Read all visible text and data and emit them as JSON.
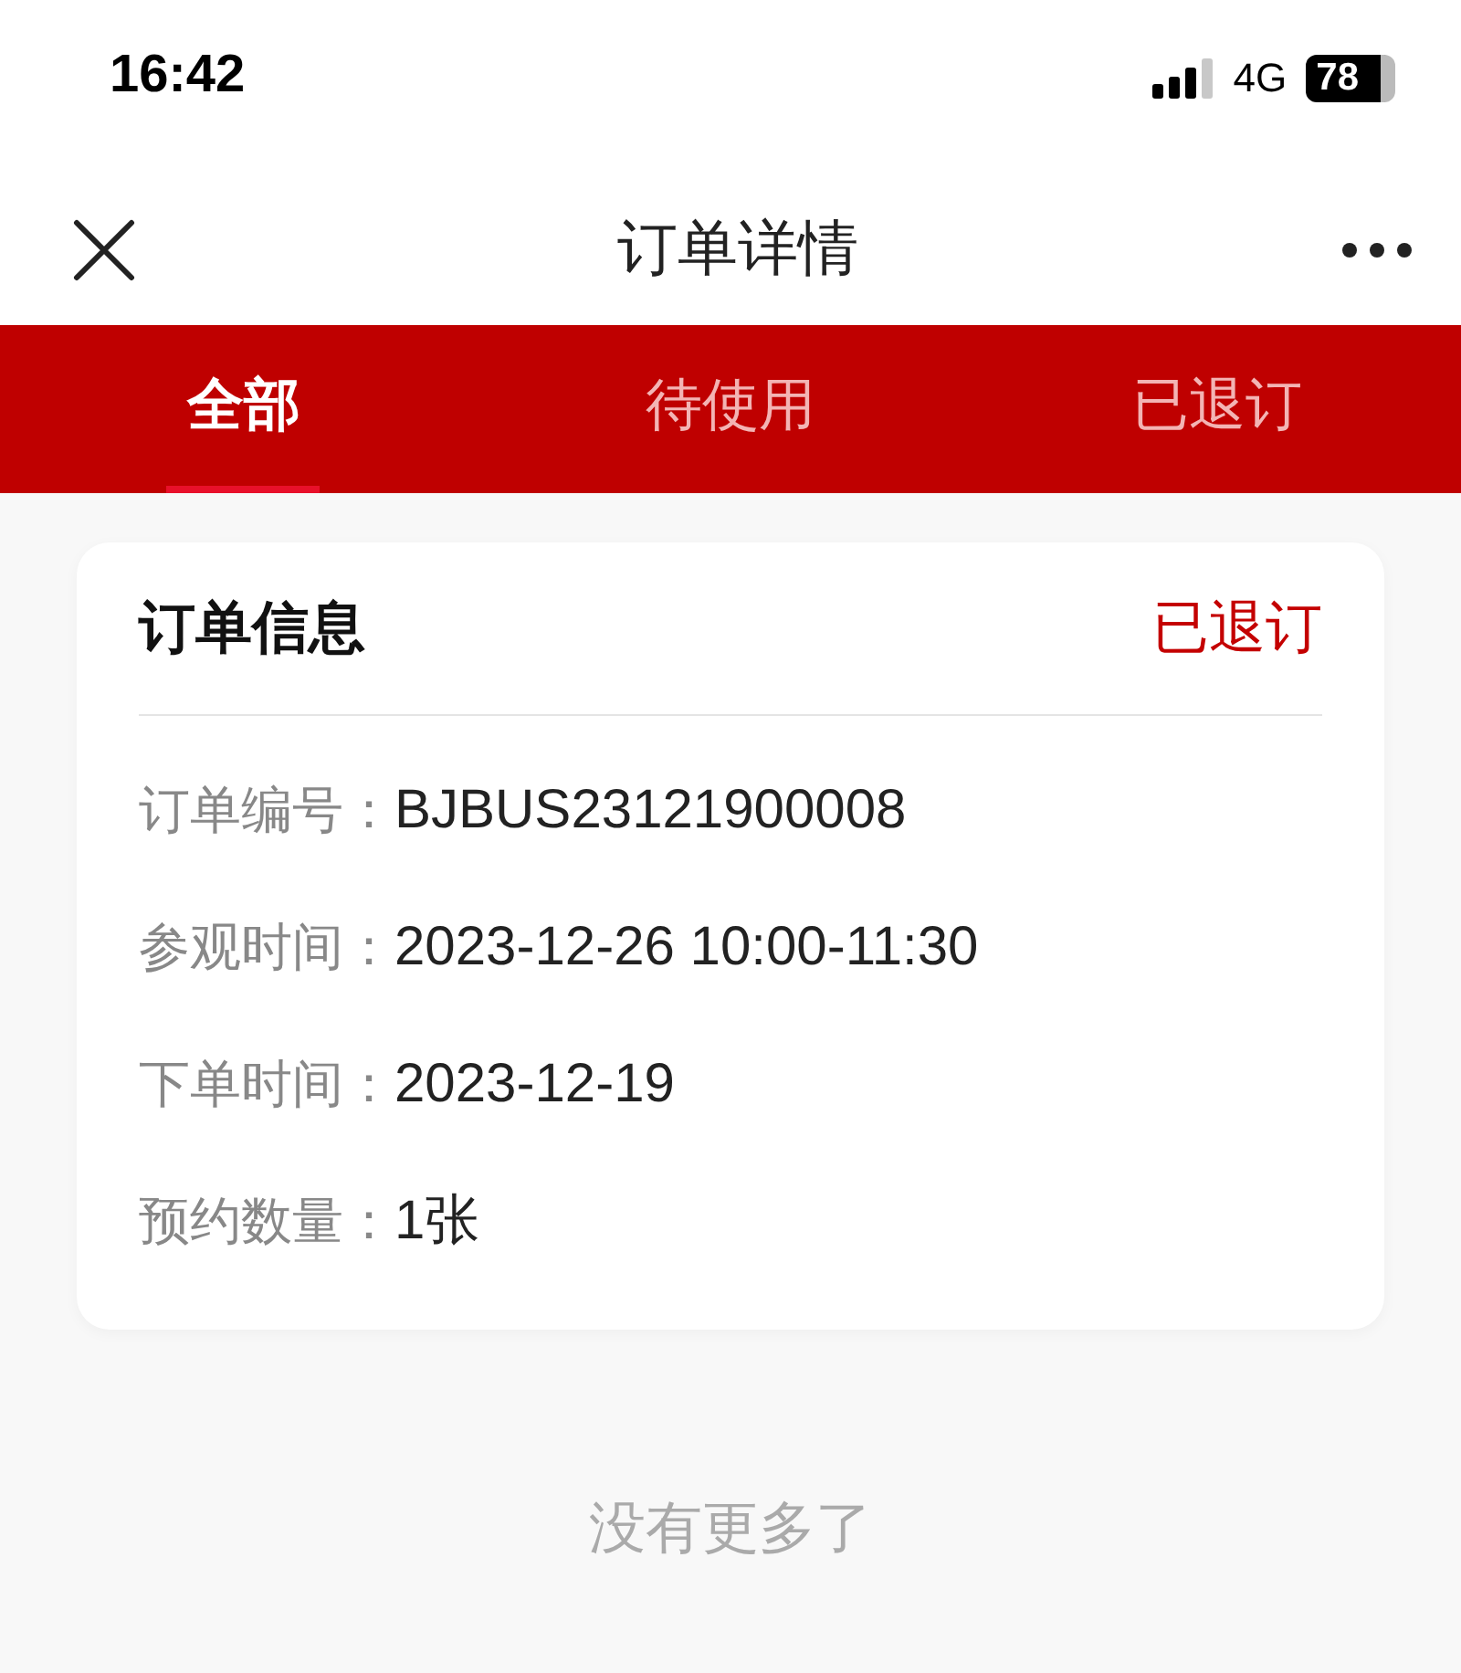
{
  "status_bar": {
    "time": "16:42",
    "network": "4G",
    "battery": "78"
  },
  "header": {
    "title": "订单详情"
  },
  "tabs": [
    {
      "label": "全部",
      "selected": true
    },
    {
      "label": "待使用",
      "selected": false
    },
    {
      "label": "已退订",
      "selected": false
    }
  ],
  "order_card": {
    "title": "订单信息",
    "status": "已退订",
    "fields": [
      {
        "label": "订单编号：",
        "value": "BJBUS23121900008"
      },
      {
        "label": "参观时间：",
        "value": "2023-12-26 10:00-11:30"
      },
      {
        "label": "下单时间：",
        "value": "2023-12-19"
      },
      {
        "label": "预约数量：",
        "value": "1张"
      }
    ]
  },
  "footer_note": "没有更多了"
}
